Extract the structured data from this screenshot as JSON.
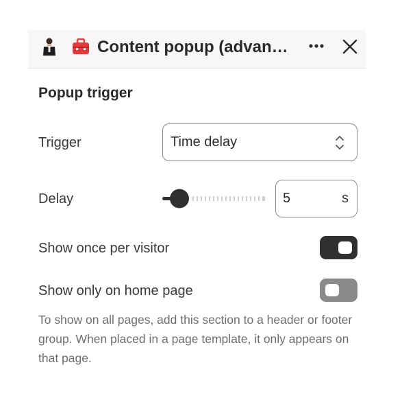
{
  "header": {
    "title": "Content popup (advan…",
    "avatar_icon": "person-avatar-icon",
    "app_icon": "red-toolbox-icon",
    "more_icon": "more-horizontal-icon",
    "close_icon": "close-icon"
  },
  "section": {
    "title": "Popup trigger"
  },
  "trigger": {
    "label": "Trigger",
    "value": "Time delay"
  },
  "delay": {
    "label": "Delay",
    "value": "5",
    "unit": "s",
    "slider_fraction": 0.0
  },
  "show_once": {
    "label": "Show once per visitor",
    "enabled": true
  },
  "home_only": {
    "label": "Show only on home page",
    "enabled": false
  },
  "help_text": "To show on all pages, add this section to a header or footer group. When placed in a page template, it only appears on that page.",
  "colors": {
    "toggle_on": "#303030",
    "toggle_off": "#8a8a8a",
    "app_icon_red": "#e23b3b"
  }
}
